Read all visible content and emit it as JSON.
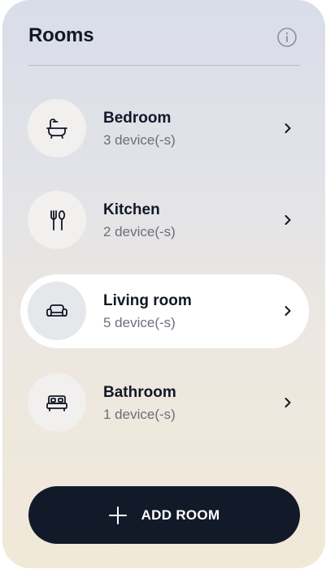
{
  "header": {
    "title": "Rooms"
  },
  "rooms": [
    {
      "name": "Bedroom",
      "count": "3 device(-s)",
      "icon": "bathtub-icon",
      "active": false
    },
    {
      "name": "Kitchen",
      "count": "2 device(-s)",
      "icon": "fork-spoon-icon",
      "active": false
    },
    {
      "name": "Living room",
      "count": "5 device(-s)",
      "icon": "sofa-icon",
      "active": true
    },
    {
      "name": "Bathroom",
      "count": "1 device(-s)",
      "icon": "bed-icon",
      "active": false
    }
  ],
  "add_button": {
    "label": "ADD ROOM"
  },
  "colors": {
    "accent_dark": "#121a2a",
    "active_row": "#ffffff"
  }
}
